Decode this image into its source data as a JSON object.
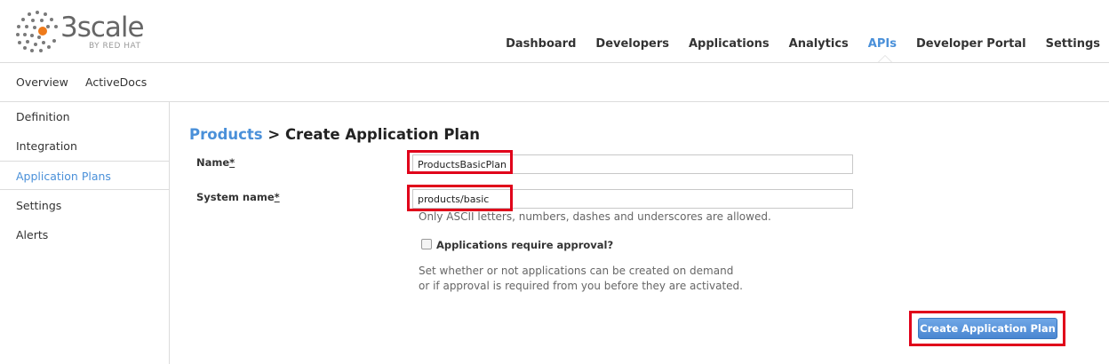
{
  "brand": {
    "logo_word": "3scale",
    "logo_sub": "BY RED HAT",
    "accent": "#4a90d9",
    "highlight": "#e0001a"
  },
  "main_nav": [
    {
      "label": "Dashboard",
      "active": false
    },
    {
      "label": "Developers",
      "active": false
    },
    {
      "label": "Applications",
      "active": false
    },
    {
      "label": "Analytics",
      "active": false
    },
    {
      "label": "APIs",
      "active": true
    },
    {
      "label": "Developer Portal",
      "active": false
    },
    {
      "label": "Settings",
      "active": false
    }
  ],
  "sub_nav": [
    "Overview",
    "ActiveDocs"
  ],
  "sidebar": [
    {
      "label": "Definition",
      "active": false
    },
    {
      "label": "Integration",
      "active": false
    },
    {
      "label": "Application Plans",
      "active": true
    },
    {
      "label": "Settings",
      "active": false
    },
    {
      "label": "Alerts",
      "active": false
    }
  ],
  "page": {
    "breadcrumb": "Products",
    "title": "> Create Application Plan"
  },
  "form": {
    "name_label": "Name",
    "name_required": "*",
    "name_value": "ProductsBasicPlan",
    "system_name_label": "System name",
    "system_name_required": "*",
    "system_name_value": "products/basic",
    "system_name_hint": "Only ASCII letters, numbers, dashes and underscores are allowed.",
    "approval_label": "Applications require approval?",
    "approval_checked": false,
    "approval_hint_line1": "Set whether or not applications can be created on demand",
    "approval_hint_line2": "or if approval is required from you before they are activated.",
    "submit_label": "Create Application Plan"
  }
}
